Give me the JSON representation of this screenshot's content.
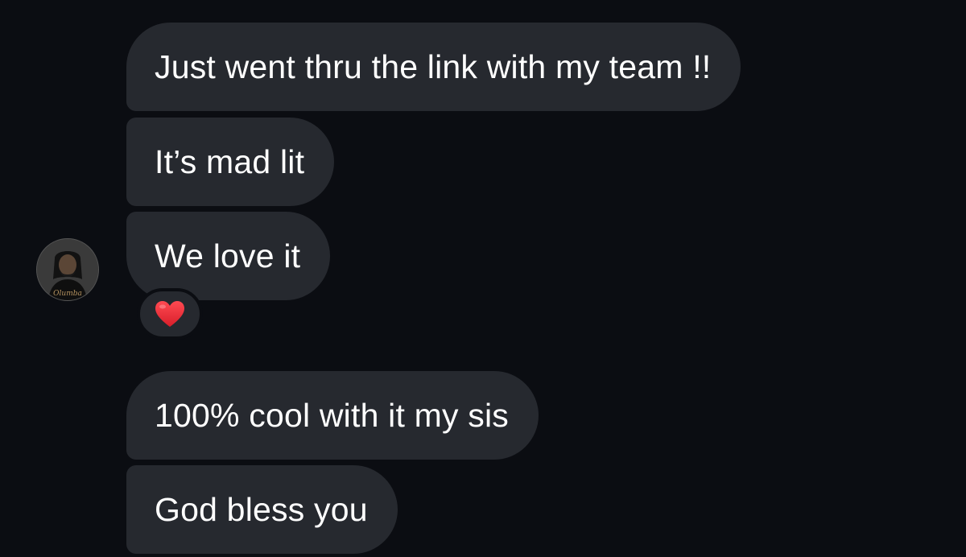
{
  "conversation": {
    "messages": [
      {
        "text": "Just went thru the link with my team !!"
      },
      {
        "text": "It’s mad lit"
      },
      {
        "text": "We love it",
        "reaction": "red-heart"
      },
      {
        "text": "100% cool with it my sis"
      },
      {
        "text": "God bless you"
      }
    ],
    "avatar_signature": "Olumba"
  },
  "colors": {
    "background": "#0b0d12",
    "bubble": "#26292f",
    "text": "#ffffff",
    "heart": "#e8303a"
  }
}
